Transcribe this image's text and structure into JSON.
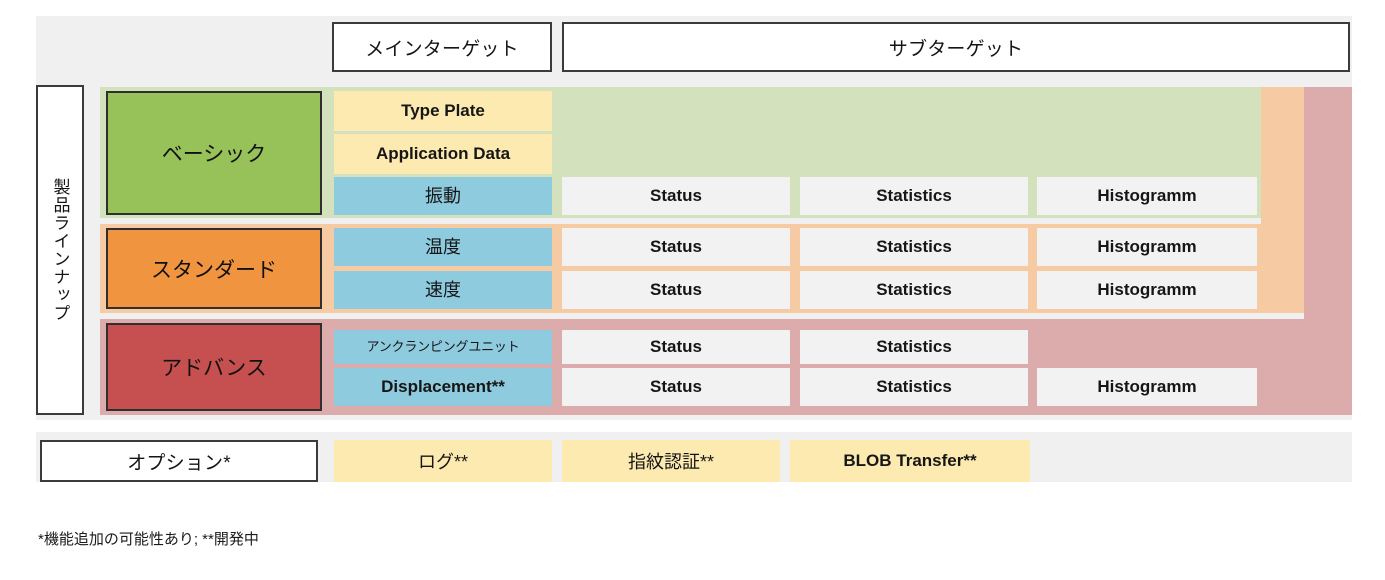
{
  "headers": {
    "main_target": "メインターゲット",
    "sub_target": "サブターゲット"
  },
  "side_label": "製品ラインナップ",
  "colors": {
    "basic_chip": "#97c159",
    "standard_chip": "#f0943f",
    "advance_chip": "#c6504f",
    "basic_band": "#d4e1bd",
    "standard_band": "#f6cba4",
    "advance_band": "#dcacad",
    "yellow_cell": "#fdeab0",
    "blue_cell": "#8ecbdf",
    "plain_cell": "#f2f2f2",
    "backdrop": "#f0f0f0",
    "outline": "#3b3b3b"
  },
  "tiers": [
    {
      "name": "ベーシック",
      "chip_color": "#97c159",
      "band_color": "#d4e1bd",
      "rows": [
        {
          "feature": "Type Plate",
          "feature_color": "#fdeab0",
          "feature_style": "en",
          "subs": []
        },
        {
          "feature": "Application Data",
          "feature_color": "#fdeab0",
          "feature_style": "en",
          "subs": []
        },
        {
          "feature": "振動",
          "feature_color": "#8ecbdf",
          "feature_style": "jp",
          "subs": [
            "Status",
            "Statistics",
            "Histogramm"
          ]
        }
      ]
    },
    {
      "name": "スタンダード",
      "chip_color": "#f0943f",
      "band_color": "#f6cba4",
      "rows": [
        {
          "feature": "温度",
          "feature_color": "#8ecbdf",
          "feature_style": "jp",
          "subs": [
            "Status",
            "Statistics",
            "Histogramm"
          ]
        },
        {
          "feature": "速度",
          "feature_color": "#8ecbdf",
          "feature_style": "jp",
          "subs": [
            "Status",
            "Statistics",
            "Histogramm"
          ]
        }
      ]
    },
    {
      "name": "アドバンス",
      "chip_color": "#c6504f",
      "band_color": "#dcacad",
      "rows": [
        {
          "feature": "アンクランピングユニット",
          "feature_color": "#8ecbdf",
          "feature_style": "small",
          "subs": [
            "Status",
            "Statistics"
          ]
        },
        {
          "feature": "Displacement**",
          "feature_color": "#8ecbdf",
          "feature_style": "en",
          "subs": [
            "Status",
            "Statistics",
            "Histogramm"
          ]
        }
      ]
    }
  ],
  "options": {
    "label": "オプション*",
    "items": [
      {
        "label": "ログ**",
        "style": "jp"
      },
      {
        "label": "指紋認証**",
        "style": "jp"
      },
      {
        "label": "BLOB Transfer**",
        "style": "en"
      }
    ]
  },
  "footnote": "*機能追加の可能性あり; **開発中"
}
